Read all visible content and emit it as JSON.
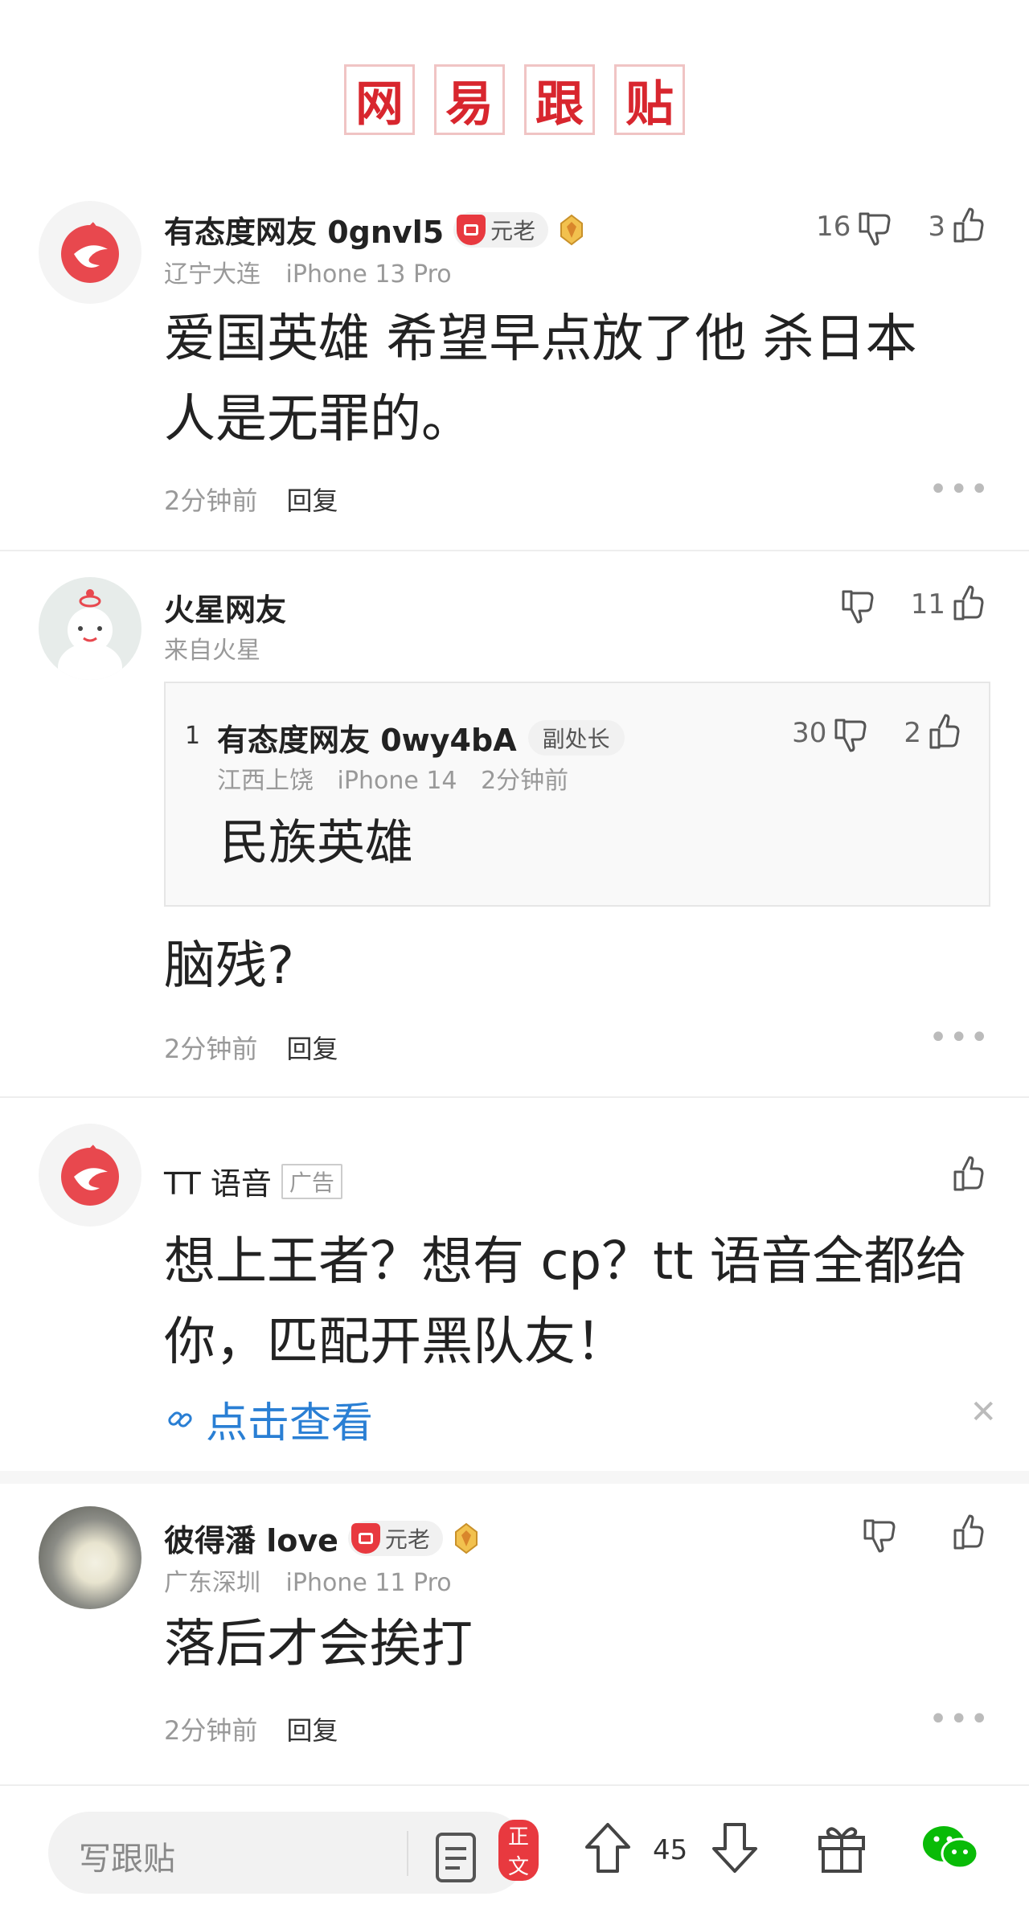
{
  "header": {
    "chars": [
      "网",
      "易",
      "跟",
      "贴"
    ]
  },
  "comments": [
    {
      "username": "有态度网友 0gnvl5",
      "badge": "元老",
      "location": "辽宁大连",
      "device": "iPhone 13 Pro",
      "dislikes": "16",
      "likes": "3",
      "text": "爱国英雄 希望早点放了他 杀日本人是无罪的。",
      "time": "2分钟前",
      "reply": "回复"
    },
    {
      "username": "火星网友",
      "location": "来自火星",
      "likes": "11",
      "quote": {
        "floor": "1",
        "username": "有态度网友 0wy4bA",
        "badge": "副处长",
        "location": "江西上饶",
        "device": "iPhone 14",
        "time": "2分钟前",
        "dislikes": "30",
        "likes": "2",
        "text": "民族英雄"
      },
      "text": "脑残?",
      "time": "2分钟前",
      "reply": "回复"
    },
    {
      "username": "彼得潘 love",
      "badge": "元老",
      "location": "广东深圳",
      "device": "iPhone 11 Pro",
      "text": "落后才会挨打",
      "time": "2分钟前",
      "reply": "回复"
    }
  ],
  "ad": {
    "name": "TT 语音",
    "tag": "广告",
    "text": "想上王者？想有 cp？tt 语音全都给你，匹配开黑队友！",
    "link": "点击查看"
  },
  "bottom_bar": {
    "placeholder": "写跟贴",
    "article_tag": "正文",
    "vote_count": "45"
  },
  "colors": {
    "brand_red": "#d8262e",
    "link_blue": "#2a7fd4",
    "wechat_green": "#09bb07"
  }
}
